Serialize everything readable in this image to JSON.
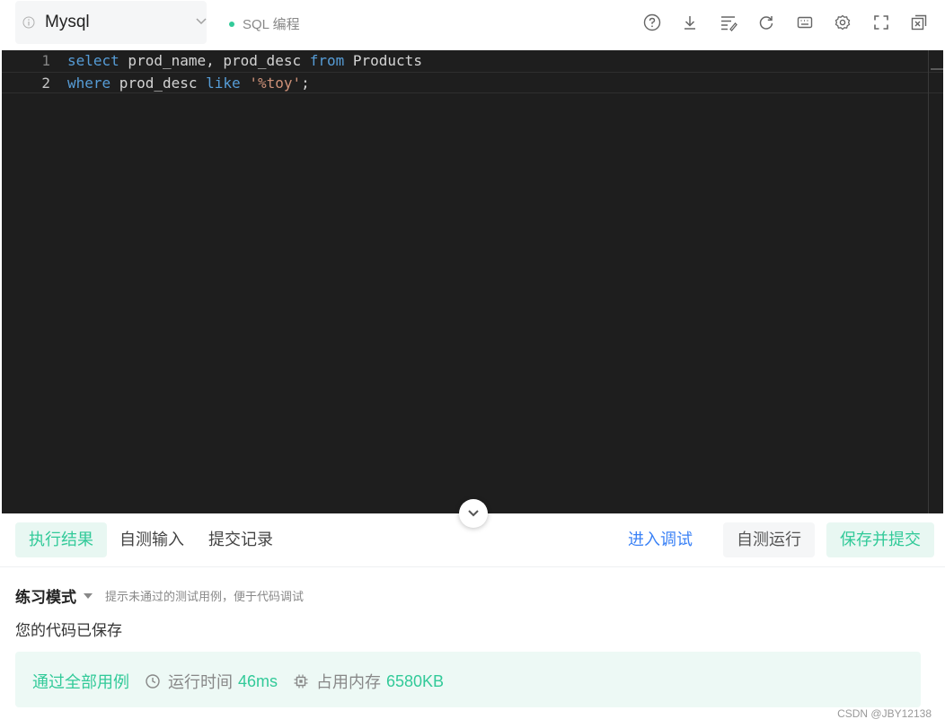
{
  "toolbar": {
    "language": "Mysql",
    "mode_label": "SQL 编程",
    "icons": [
      "help-icon",
      "download-icon",
      "format-icon",
      "reset-icon",
      "keyboard-icon",
      "settings-icon",
      "fullscreen-icon",
      "close-panel-icon"
    ]
  },
  "editor": {
    "lines": [
      {
        "number": "1",
        "tokens": [
          {
            "t": "select",
            "k": "kw"
          },
          {
            "t": " prod_name, prod_desc ",
            "k": "id"
          },
          {
            "t": "from",
            "k": "kw"
          },
          {
            "t": " Products",
            "k": "id"
          }
        ]
      },
      {
        "number": "2",
        "tokens": [
          {
            "t": "where",
            "k": "kw"
          },
          {
            "t": " prod_desc ",
            "k": "id"
          },
          {
            "t": "like",
            "k": "kw"
          },
          {
            "t": " ",
            "k": "id"
          },
          {
            "t": "'%toy'",
            "k": "str"
          },
          {
            "t": ";",
            "k": "id"
          }
        ]
      }
    ]
  },
  "tabs": [
    "执行结果",
    "自测输入",
    "提交记录"
  ],
  "actions": {
    "debug": "进入调试",
    "run": "自测运行",
    "submit": "保存并提交"
  },
  "result": {
    "practice_mode": "练习模式",
    "practice_hint": "提示未通过的测试用例，便于代码调试",
    "saved_message": "您的代码已保存",
    "pass_label": "通过全部用例",
    "time_label": "运行时间",
    "time_value": "46ms",
    "memory_label": "占用内存",
    "memory_value": "6580KB"
  },
  "watermark": "CSDN @JBY12138",
  "colors": {
    "accent": "#32ca99",
    "link": "#3b82f6",
    "editor_bg": "#1e1e1e",
    "keyword": "#569cd6",
    "string": "#ce9178"
  }
}
